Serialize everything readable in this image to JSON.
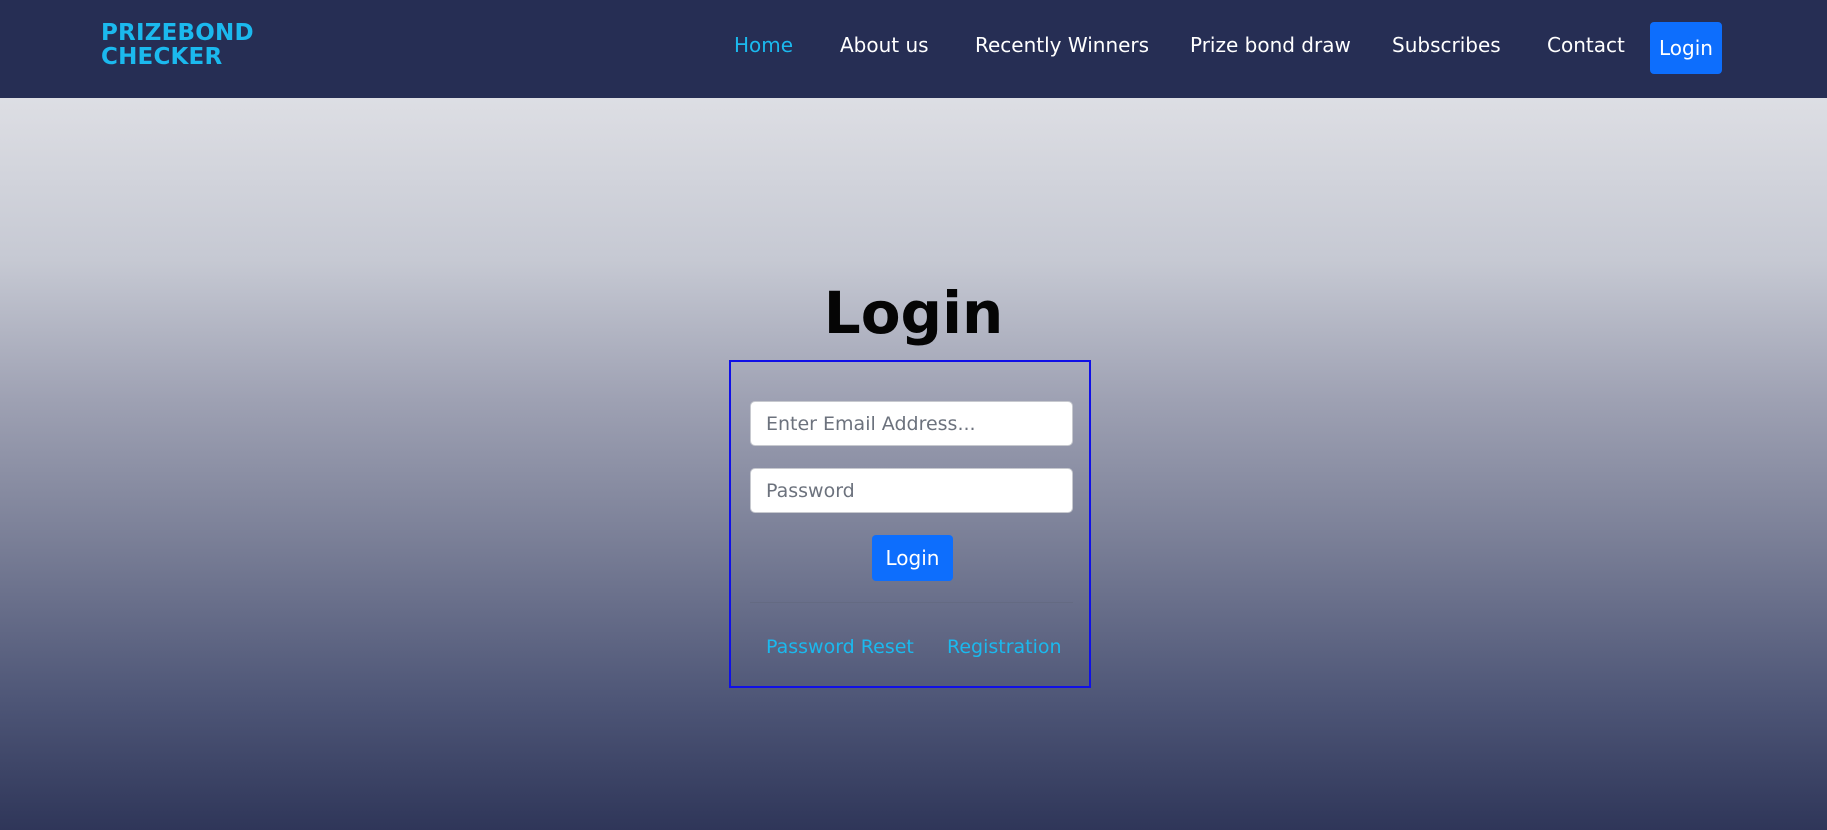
{
  "brand": {
    "line1": "PRIZEBOND",
    "line2": "CHECKER"
  },
  "nav": {
    "items": [
      {
        "label": "Home",
        "active": true
      },
      {
        "label": "About us",
        "active": false
      },
      {
        "label": "Recently Winners",
        "active": false
      },
      {
        "label": "Prize bond draw",
        "active": false
      },
      {
        "label": "Subscribes",
        "active": false
      },
      {
        "label": "Contact",
        "active": false
      }
    ],
    "login_label": "Login"
  },
  "login_form": {
    "title": "Login",
    "email_placeholder": "Enter Email Address...",
    "password_placeholder": "Password",
    "submit_label": "Login",
    "reset_link": "Password Reset",
    "register_link": "Registration"
  },
  "colors": {
    "navbar": "#262e54",
    "accent": "#1bb9ee",
    "button": "#0d6efd",
    "form_border": "#1010e6"
  }
}
